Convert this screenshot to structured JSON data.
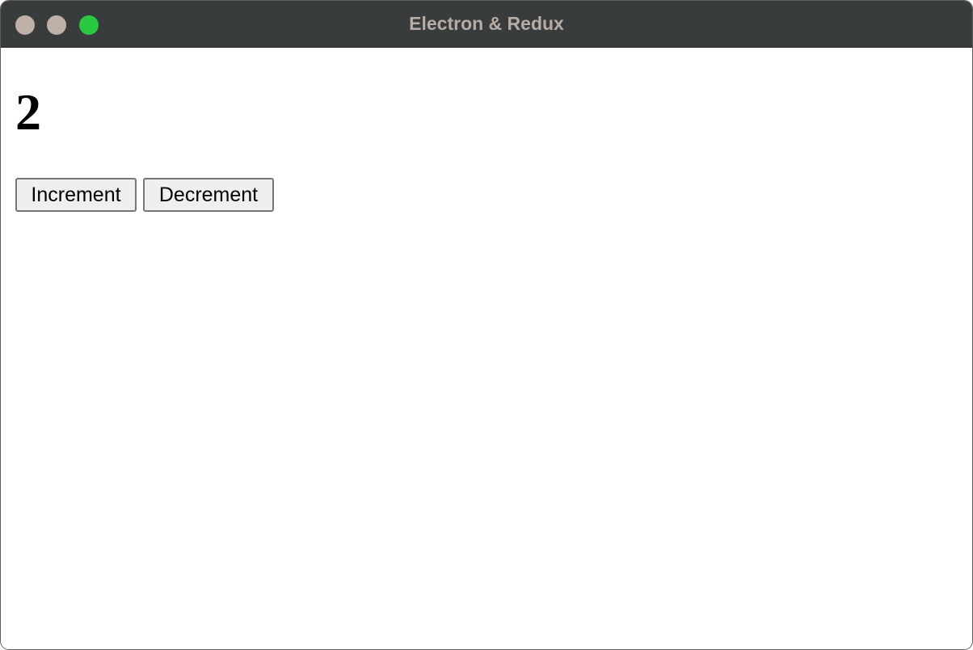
{
  "window": {
    "title": "Electron & Redux",
    "traffic_lights": {
      "close_color": "#bfb1a8",
      "minimize_color": "#bfb1a8",
      "zoom_color": "#28c840"
    }
  },
  "counter": {
    "value": "2"
  },
  "buttons": {
    "increment_label": "Increment",
    "decrement_label": "Decrement"
  }
}
